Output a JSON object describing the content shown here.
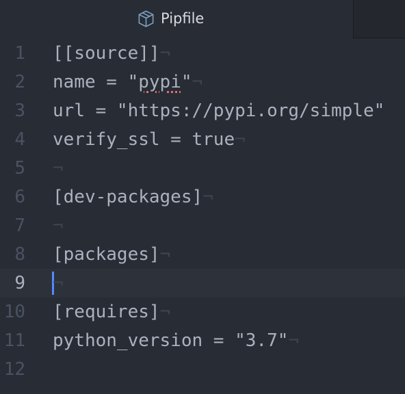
{
  "tab": {
    "title": "Pipfile",
    "icon": "package-icon"
  },
  "editor": {
    "current_line": 9,
    "invisible_eol": "¬",
    "lines": [
      {
        "number": "1",
        "text": "[[source]]",
        "eol": "¬"
      },
      {
        "number": "2",
        "pre": "name = \"",
        "spell": "pypi",
        "post": "\"",
        "eol": "¬"
      },
      {
        "number": "3",
        "text": "url = \"https://pypi.org/simple\"",
        "eol": ""
      },
      {
        "number": "4",
        "text": "verify_ssl = true",
        "eol": "¬"
      },
      {
        "number": "5",
        "text": "",
        "eol": "¬"
      },
      {
        "number": "6",
        "text": "[dev-packages]",
        "eol": "¬"
      },
      {
        "number": "7",
        "text": "",
        "eol": "¬"
      },
      {
        "number": "8",
        "text": "[packages]",
        "eol": "¬"
      },
      {
        "number": "9",
        "text": "",
        "eol": "¬"
      },
      {
        "number": "10",
        "text": "[requires]",
        "eol": "¬"
      },
      {
        "number": "11",
        "text": "python_version = \"3.7\"",
        "eol": "¬"
      },
      {
        "number": "12",
        "text": "",
        "eol": ""
      }
    ]
  },
  "colors": {
    "background": "#282c34",
    "text": "#abb2bf",
    "gutter": "#4b5263",
    "cursor": "#528bff",
    "spell_error": "#e06c75"
  }
}
